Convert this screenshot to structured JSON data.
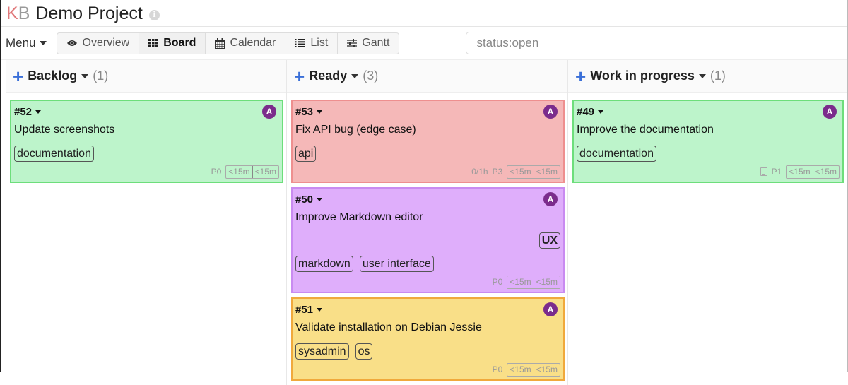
{
  "header": {
    "logo_k": "K",
    "logo_b": "B",
    "project_name": "Demo Project",
    "info_icon": "info-icon"
  },
  "toolbar": {
    "menu_label": "Menu",
    "views": [
      {
        "label": "Overview",
        "icon": "eye-icon",
        "active": false
      },
      {
        "label": "Board",
        "icon": "grid-icon",
        "active": true
      },
      {
        "label": "Calendar",
        "icon": "calendar-icon",
        "active": false
      },
      {
        "label": "List",
        "icon": "list-icon",
        "active": false
      },
      {
        "label": "Gantt",
        "icon": "sliders-icon",
        "active": false
      }
    ],
    "search_value": "status:open"
  },
  "columns": [
    {
      "title": "Backlog",
      "count": "(1)",
      "cards": [
        {
          "id": "#52",
          "title": "Update screenshots",
          "color": "green",
          "tags": [
            "documentation"
          ],
          "priority": "P0",
          "time_spent": "<15m",
          "time_estimated": "<15m",
          "avatar": "A"
        }
      ]
    },
    {
      "title": "Ready",
      "count": "(3)",
      "cards": [
        {
          "id": "#53",
          "title": "Fix API bug (edge case)",
          "color": "red",
          "tags": [
            "api"
          ],
          "subtasks": "0/1h",
          "priority": "P3",
          "time_spent": "<15m",
          "time_estimated": "<15m",
          "avatar": "A"
        },
        {
          "id": "#50",
          "title": "Improve Markdown editor",
          "color": "purple",
          "category": "UX",
          "tags": [
            "markdown",
            "user interface"
          ],
          "priority": "P0",
          "time_spent": "<15m",
          "time_estimated": "<15m",
          "avatar": "A"
        },
        {
          "id": "#51",
          "title": "Validate installation on Debian Jessie",
          "color": "yellow",
          "tags": [
            "sysadmin",
            "os"
          ],
          "priority": "P0",
          "time_spent": "<15m",
          "time_estimated": "<15m",
          "avatar": "A"
        }
      ]
    },
    {
      "title": "Work in progress",
      "count": "(1)",
      "cards": [
        {
          "id": "#49",
          "title": "Improve the documentation",
          "color": "green",
          "tags": [
            "documentation"
          ],
          "has_description": true,
          "priority": "P1",
          "time_spent": "<15m",
          "time_estimated": "<15m",
          "avatar": "A"
        }
      ]
    }
  ],
  "colors": {
    "green": "#bdf4cb",
    "red": "#f5b8b8",
    "purple": "#dfaefb",
    "yellow": "#f9df88",
    "avatar": "#7b2c8c",
    "add_icon": "#3a6fd8"
  }
}
